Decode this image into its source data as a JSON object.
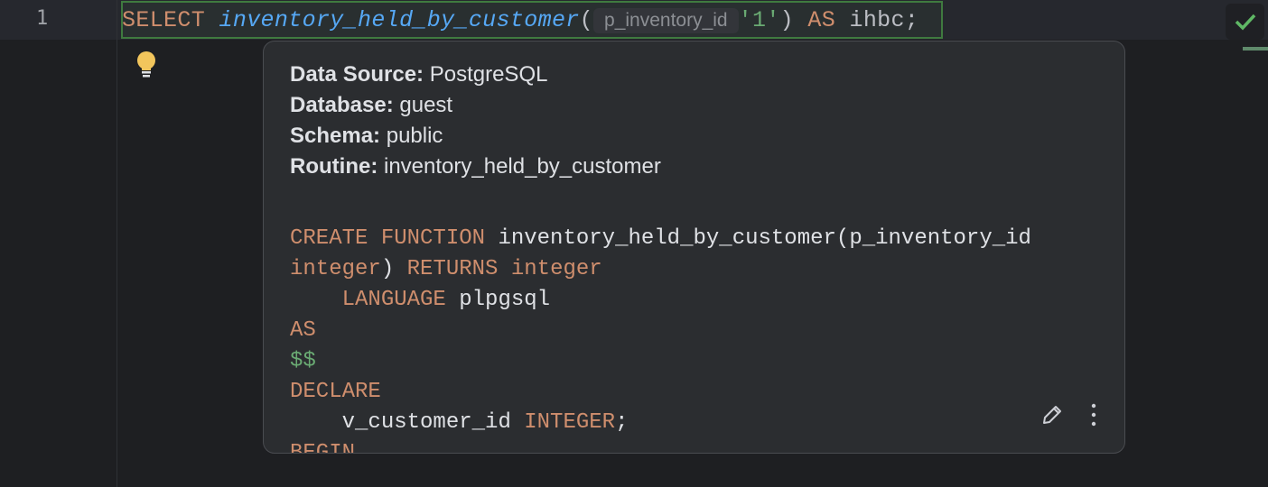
{
  "editor": {
    "line_number": "1",
    "tokens": {
      "select": "SELECT",
      "function": "inventory_held_by_customer",
      "open_paren": "(",
      "param_hint": "p_inventory_id",
      "arg": "'1'",
      "close": ")",
      "as": "AS",
      "alias": "ihbc",
      "semi": ";"
    }
  },
  "popup": {
    "meta": [
      {
        "label": "Data Source:",
        "value": "PostgreSQL"
      },
      {
        "label": "Database:",
        "value": "guest"
      },
      {
        "label": "Schema:",
        "value": "public"
      },
      {
        "label": "Routine:",
        "value": "inventory_held_by_customer"
      }
    ],
    "source": {
      "l1_kw": "CREATE FUNCTION",
      "l1_rest": " inventory_held_by_customer(p_inventory_id",
      "l2_a": "integer",
      "l2_b": ") ",
      "l2_kw": "RETURNS",
      "l2_c": " ",
      "l2_d": "integer",
      "l3_kw": "    LANGUAGE",
      "l3_rest": " plpgsql",
      "l4": "AS",
      "l5": "$$",
      "l6": "DECLARE",
      "l7_a": "    v_customer_id ",
      "l7_kw": "INTEGER",
      "l7_b": ";",
      "l8": "BEGIN"
    }
  },
  "colors": {
    "keyword": "#cf8e6d",
    "function": "#56a8f5",
    "string": "#6aab73",
    "ok": "#5fb865"
  }
}
